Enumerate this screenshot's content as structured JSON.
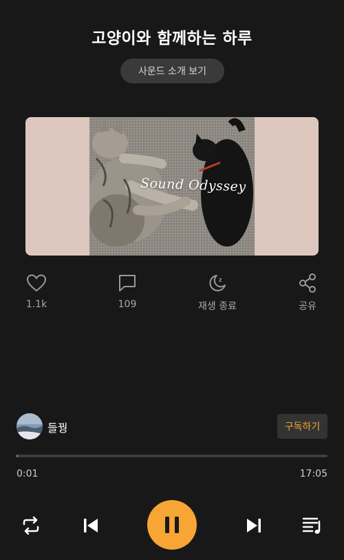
{
  "player": {
    "title": "고양이와 함께하는 하루",
    "intro_button": "사운드 소개 보기",
    "cover_watermark": "Sound Odyssey"
  },
  "actions": {
    "like_count": "1.1k",
    "comment_count": "109",
    "sleep_timer_label": "재생 종료",
    "share_label": "공유"
  },
  "artist": {
    "name": "들꿩",
    "subscribe_label": "구독하기"
  },
  "progress": {
    "current_time": "0:01",
    "total_time": "17:05",
    "fraction": 0.001
  },
  "controls": {
    "icons": [
      "repeat-icon",
      "skip-previous-icon",
      "pause-icon",
      "skip-next-icon",
      "playlist-icon"
    ]
  },
  "colors": {
    "background": "#181818",
    "accent": "#f7a535",
    "subscribe_text": "#f2a33a",
    "cover_bg": "#dcc6bd"
  }
}
